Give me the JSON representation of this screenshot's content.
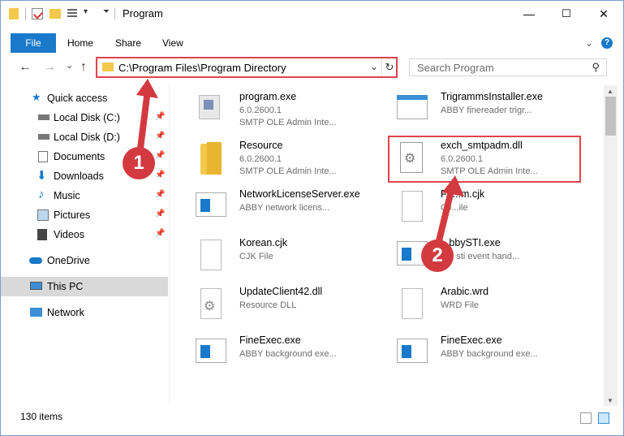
{
  "window": {
    "title": "Program",
    "controls": {
      "minimize": "—",
      "maximize": "☐",
      "close": "✕"
    }
  },
  "ribbon": {
    "file": "File",
    "tabs": [
      "Home",
      "Share",
      "View"
    ],
    "help": "?"
  },
  "nav": {
    "back": "←",
    "forward": "→",
    "recent": "⌄",
    "up": "↑"
  },
  "address": {
    "path": "C:\\Program Files\\Program Directory",
    "refresh": "↻",
    "dropdown": "⌄"
  },
  "search": {
    "placeholder": "Search Program"
  },
  "sidebar": {
    "items": [
      {
        "label": "Quick access",
        "icon": "star-icon"
      },
      {
        "label": "Local Disk (C:)",
        "icon": "drive-icon"
      },
      {
        "label": "Local Disk (D:)",
        "icon": "drive-icon"
      },
      {
        "label": "Documents",
        "icon": "documents-icon"
      },
      {
        "label": "Downloads",
        "icon": "download-icon"
      },
      {
        "label": "Music",
        "icon": "music-icon"
      },
      {
        "label": "Pictures",
        "icon": "pictures-icon"
      },
      {
        "label": "Videos",
        "icon": "videos-icon"
      },
      {
        "label": "OneDrive",
        "icon": "cloud-icon"
      },
      {
        "label": "This PC",
        "icon": "computer-icon"
      },
      {
        "label": "Network",
        "icon": "network-icon"
      }
    ]
  },
  "files": [
    {
      "name": "program.exe",
      "line2": "6.0.2600.1",
      "line3": "SMTP OLE Admin Inte...",
      "icon": "exe-icon"
    },
    {
      "name": "TrigrammsInstaller.exe",
      "line2": "ABBY finereader trigr...",
      "line3": "",
      "icon": "window-icon"
    },
    {
      "name": "Resource",
      "line2": "6.0.2600.1",
      "line3": "SMTP OLE Admin Inte...",
      "icon": "folder-icon"
    },
    {
      "name": "exch_smtpadm.dll",
      "line2": "6.0.2600.1",
      "line3": "SMTP OLE Admin Inte...",
      "icon": "dll-icon"
    },
    {
      "name": "NetworkLicenseServer.exe",
      "line2": "ABBY network licens...",
      "line3": "",
      "icon": "window-icon"
    },
    {
      "name": "Fe...m.cjk",
      "line2": "CJ...ile",
      "line3": "",
      "icon": "file-icon"
    },
    {
      "name": "Korean.cjk",
      "line2": "CJK File",
      "line3": "",
      "icon": "file-icon"
    },
    {
      "name": "...bbySTI.exe",
      "line2": "...Y sti event hand...",
      "line3": "",
      "icon": "window-icon"
    },
    {
      "name": "UpdateClient42.dll",
      "line2": "Resource DLL",
      "line3": "",
      "icon": "dll-icon"
    },
    {
      "name": "Arabic.wrd",
      "line2": "WRD File",
      "line3": "",
      "icon": "file-icon"
    },
    {
      "name": "FineExec.exe",
      "line2": "ABBY background exe...",
      "line3": "",
      "icon": "window-icon"
    },
    {
      "name": "FineExec.exe",
      "line2": "ABBY background exe...",
      "line3": "",
      "icon": "window-icon"
    }
  ],
  "status": {
    "count": "130 items"
  },
  "annotations": [
    {
      "label": "1"
    },
    {
      "label": "2"
    }
  ],
  "colors": {
    "accent": "#1979ca",
    "highlight": "#e0434b",
    "arrow": "#d33a3f",
    "selected": "#d9d9d9"
  }
}
